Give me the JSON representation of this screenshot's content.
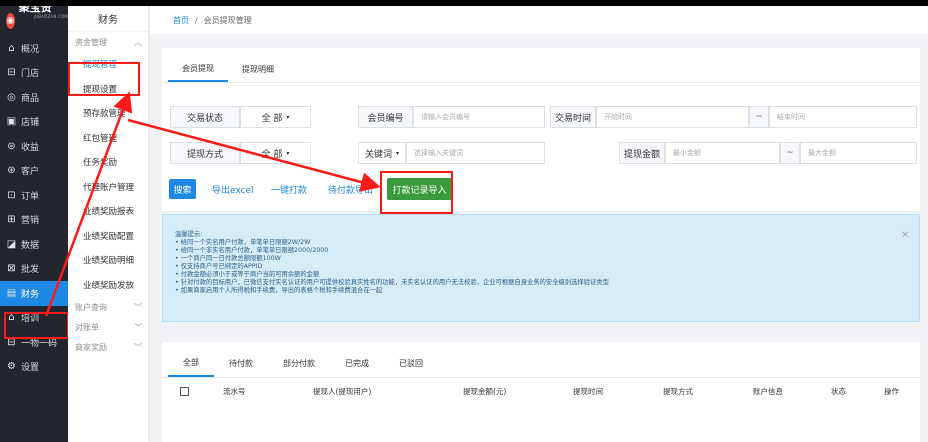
{
  "brand": {
    "name": "聚宝赞",
    "sub": "JUBAOZAN.COM",
    "mark": "◉"
  },
  "nav": [
    {
      "icon": "⌂",
      "label": "概况"
    },
    {
      "icon": "⊟",
      "label": "门店"
    },
    {
      "icon": "◎",
      "label": "商品"
    },
    {
      "icon": "▣",
      "label": "店铺"
    },
    {
      "icon": "⊜",
      "label": "收益"
    },
    {
      "icon": "⊛",
      "label": "客户"
    },
    {
      "icon": "⊡",
      "label": "订单"
    },
    {
      "icon": "⊞",
      "label": "营销"
    },
    {
      "icon": "◪",
      "label": "数据"
    },
    {
      "icon": "⊠",
      "label": "批发"
    },
    {
      "icon": "▤",
      "label": "财务"
    },
    {
      "icon": "⌂",
      "label": "培训"
    },
    {
      "icon": "⊟",
      "label": "一物一码"
    },
    {
      "icon": "⚙",
      "label": "设置"
    }
  ],
  "subnav": {
    "title": "财务",
    "group1": "资金管理",
    "items": [
      "提现管理",
      "提现设置",
      "预存款管理",
      "红包管理",
      "任务奖励",
      "代理账户管理",
      "业绩奖励报表",
      "业绩奖励配置",
      "业绩奖励明细",
      "业绩奖励发放"
    ],
    "group2": "账户查询",
    "group3": "对账单",
    "group4": "商家奖励"
  },
  "breadcrumb": {
    "home": "首页",
    "sep": "/",
    "current": "会员提现管理"
  },
  "tabs1": [
    "会员提现",
    "提现明细"
  ],
  "filters": {
    "trade_status_label": "交易状态",
    "trade_status_value": "全 部",
    "member_no_label": "会员编号",
    "member_no_placeholder": "请输入会员编号",
    "trade_time_label": "交易时间",
    "start_placeholder": "开始时间",
    "tilde": "~",
    "end_placeholder": "结束时间",
    "method_label": "提现方式",
    "method_value": "全 部",
    "keyword_label": "关键词",
    "keyword_placeholder": "选择输入关键词",
    "amount_label": "提现金额",
    "min_placeholder": "最小金额",
    "max_placeholder": "最大金额"
  },
  "actions": {
    "search": "搜索",
    "export": "导出excel",
    "pay_all": "一键打款",
    "pending_export": "待付款导出",
    "import": "打款记录导入"
  },
  "tips": {
    "title": "温馨提示:",
    "lines": [
      "• 给同一个实名用户付款，单笔单日限额2W/2W",
      "• 给同一个非实名用户付款，单笔单日限额2000/2000",
      "• 一个商户同一日付款总额限额100W",
      "• 仅支持商户号已绑定的APPID",
      "• 付款金额必须小于或等于商户当前可用余额的金额",
      "• 针对付款的目标用户，已微信支付实名认证的用户可提供校验真实姓名的功能，未实名认证的用户无法校验，企业可根据自身业务的安全级别选择验证类型",
      "• 如果商家启用个人所得税和手续费，导出的表格个税和手续费混合在一起"
    ],
    "close": "×"
  },
  "tabs2": [
    "全部",
    "待付款",
    "部分付款",
    "已完成",
    "已驳回"
  ],
  "table_headers": [
    "流水号",
    "提现人(提现用户)",
    "提现金额(元)",
    "提现时间",
    "提现方式",
    "账户信息",
    "状态",
    "操作"
  ],
  "colors": {
    "accent": "#1e88e5",
    "nav_bg": "#23262e",
    "highlight": "#ff1a1a",
    "green": "#3a9a3e"
  }
}
